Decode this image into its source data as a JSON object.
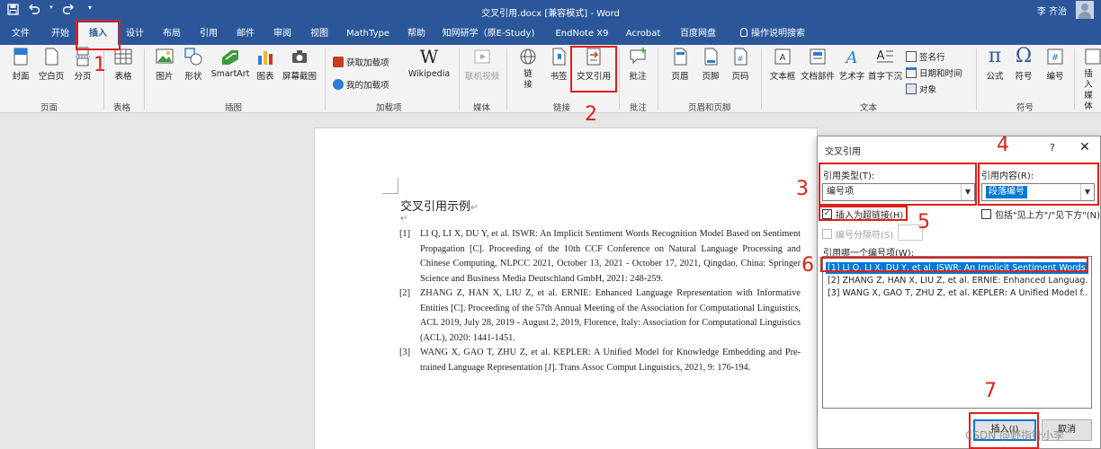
{
  "titlebar": {
    "qat_icons": [
      "save-icon",
      "undo-icon",
      "redo-icon",
      "customize-icon"
    ],
    "doc_title": "交叉引用.docx [兼容模式] - Word",
    "user_name": "李 齐治"
  },
  "tabs": [
    "文件",
    "开始",
    "插入",
    "设计",
    "布局",
    "引用",
    "邮件",
    "审阅",
    "视图",
    "MathType",
    "帮助",
    "知网研学（原E-Study)",
    "EndNote X9",
    "Acrobat",
    "百度网盘",
    "操作说明搜索"
  ],
  "active_tab": "插入",
  "ribbon": {
    "pages": {
      "cover": "封面",
      "blank": "空白页",
      "break": "分页",
      "group": "页面"
    },
    "tables": {
      "table": "表格",
      "group": "表格"
    },
    "illustrations": {
      "picture": "图片",
      "shapes": "形状",
      "smartart": "SmartArt",
      "chart": "图表",
      "screenshot": "屏幕截图",
      "group": "插图"
    },
    "addins": {
      "get": "获取加载项",
      "my": "我的加载项",
      "wikipedia": "Wikipedia",
      "group": "加载项"
    },
    "media": {
      "video": "联机视频",
      "group": "媒体"
    },
    "links": {
      "link": "链接",
      "bookmark": "书签",
      "crossref": "交叉引用",
      "group": "链接"
    },
    "comments": {
      "comment": "批注",
      "group": "批注"
    },
    "header_footer": {
      "header": "页眉",
      "footer": "页脚",
      "pagenum": "页码",
      "group": "页眉和页脚"
    },
    "text": {
      "textbox": "文本框",
      "parts": "文档部件",
      "wordart": "艺术字",
      "dropcap": "首字下沉",
      "signature": "签名行",
      "datetime": "日期和时间",
      "object": "对象",
      "group": "文本"
    },
    "symbols": {
      "equation": "公式",
      "symbol": "符号",
      "number": "编号",
      "group": "符号"
    },
    "embed": {
      "insert_media": "插入媒体"
    }
  },
  "document": {
    "heading": "交叉引用示例",
    "references": [
      {
        "num": "[1]",
        "text": "LI Q, LI X, DU Y, et al. ISWR: An Implicit Sentiment Words Recognition Model Based on Sentiment Propagation [C]. Proceeding of the 10th CCF Conference on Natural Language Processing and Chinese Computing, NLPCC 2021, October 13, 2021 - October 17, 2021, Qingdao, China: Springer Science and Business Media Deutschland GmbH, 2021: 248-259."
      },
      {
        "num": "[2]",
        "text": "ZHANG Z, HAN X, LIU Z, et al. ERNIE: Enhanced Language Representation with Informative Entities [C]. Proceeding of the 57th Annual Meeting of the Association for Computational Linguistics, ACL 2019, July 28, 2019 - August 2, 2019, Florence, Italy: Association for Computational Linguistics (ACL), 2020: 1441-1451."
      },
      {
        "num": "[3]",
        "text": "WANG X, GAO T, ZHU Z, et al. KEPLER: A Unified Model for Knowledge Embedding and Pre-trained Language Representation [J]. Trans Assoc Comput Linguistics, 2021, 9: 176-194."
      }
    ]
  },
  "dialog": {
    "title": "交叉引用",
    "help": "?",
    "close": "✕",
    "ref_type_label": "引用类型(T):",
    "ref_type_value": "编号项",
    "ref_content_label": "引用内容(R):",
    "ref_content_value": "段落编号",
    "insert_hyperlink": "插入为超链接(H)",
    "include_above_below": "包括\"见上方\"/\"见下方\"(N)",
    "separator_label": "编号分隔符(S)",
    "list_label": "引用哪一个编号项(W):",
    "items": [
      "[1] LI Q, LI X, DU Y, et al. ISWR: An Implicit Sentiment Words...",
      "[2] ZHANG Z, HAN X, LIU Z, et al. ERNIE: Enhanced Languag...",
      "[3] WANG X, GAO T, ZHU Z, et al. KEPLER: A Unified Model f..."
    ],
    "insert_button": "插入(I)",
    "cancel_button": "取消"
  },
  "annotations": [
    "1",
    "2",
    "3",
    "4",
    "5",
    "6",
    "7"
  ],
  "watermark": "CSDN @野指针小李",
  "colors": {
    "word_blue": "#2b579a",
    "annotation_red": "#e0201a",
    "selection_blue": "#0078d7"
  }
}
